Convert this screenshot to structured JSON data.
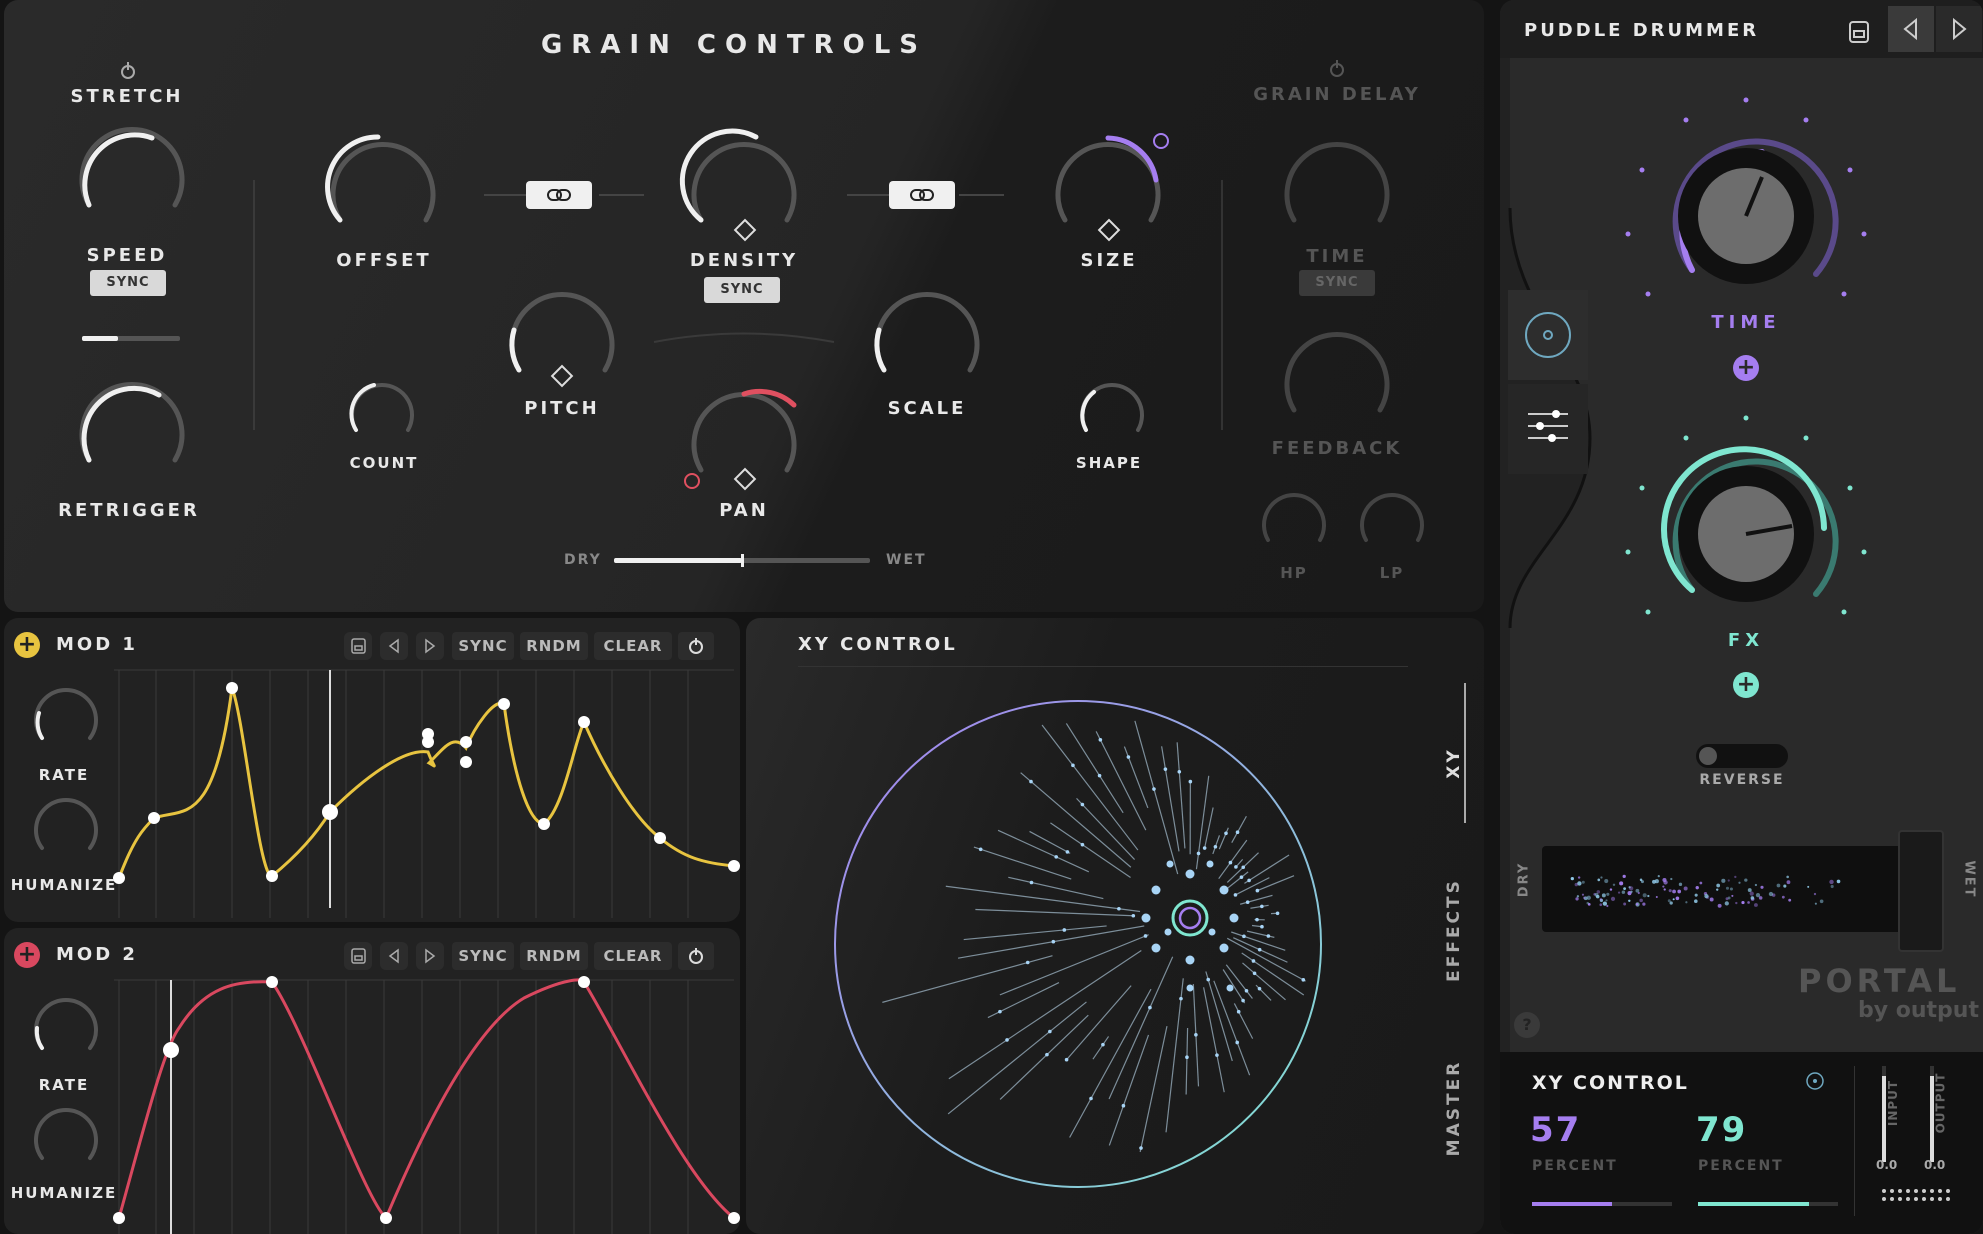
{
  "grain": {
    "title": "GRAIN CONTROLS",
    "stretch": "STRETCH",
    "speed": "SPEED",
    "speed_sync": "SYNC",
    "retrigger": "RETRIGGER",
    "offset": "OFFSET",
    "count": "COUNT",
    "pitch": "PITCH",
    "density": "DENSITY",
    "density_sync": "SYNC",
    "pan": "PAN",
    "scale": "SCALE",
    "size": "SIZE",
    "shape": "SHAPE",
    "dry": "DRY",
    "wet": "WET",
    "dry_wet_value": 0.5
  },
  "grain_delay": {
    "title": "GRAIN DELAY",
    "time": "TIME",
    "time_sync": "SYNC",
    "feedback": "FEEDBACK",
    "hp": "HP",
    "lp": "LP"
  },
  "mod1": {
    "title": "MOD 1",
    "sync": "SYNC",
    "rndm": "RNDM",
    "clear": "CLEAR",
    "rate": "RATE",
    "humanize": "HUMANIZE",
    "color": "#e8c440"
  },
  "mod2": {
    "title": "MOD 2",
    "sync": "SYNC",
    "rndm": "RNDM",
    "clear": "CLEAR",
    "rate": "RATE",
    "humanize": "HUMANIZE",
    "color": "#d9485f"
  },
  "xy": {
    "title": "XY CONTROL",
    "tabs": [
      "XY",
      "EFFECTS",
      "MASTER"
    ]
  },
  "right": {
    "preset_name": "PUDDLE DRUMMER",
    "time": "TIME",
    "fx": "FX",
    "reverse": "REVERSE",
    "dry": "DRY",
    "wet": "WET",
    "logo": "PORTAL",
    "logo_by": "by output",
    "help": "?",
    "accent_purple": "#a57ef0",
    "accent_teal": "#7fe6d0"
  },
  "xy_readout": {
    "title": "XY CONTROL",
    "x_value": "57",
    "x_unit": "PERCENT",
    "y_value": "79",
    "y_unit": "PERCENT",
    "input": "INPUT",
    "output": "OUTPUT",
    "input_value": "0.0",
    "output_value": "0.0"
  }
}
